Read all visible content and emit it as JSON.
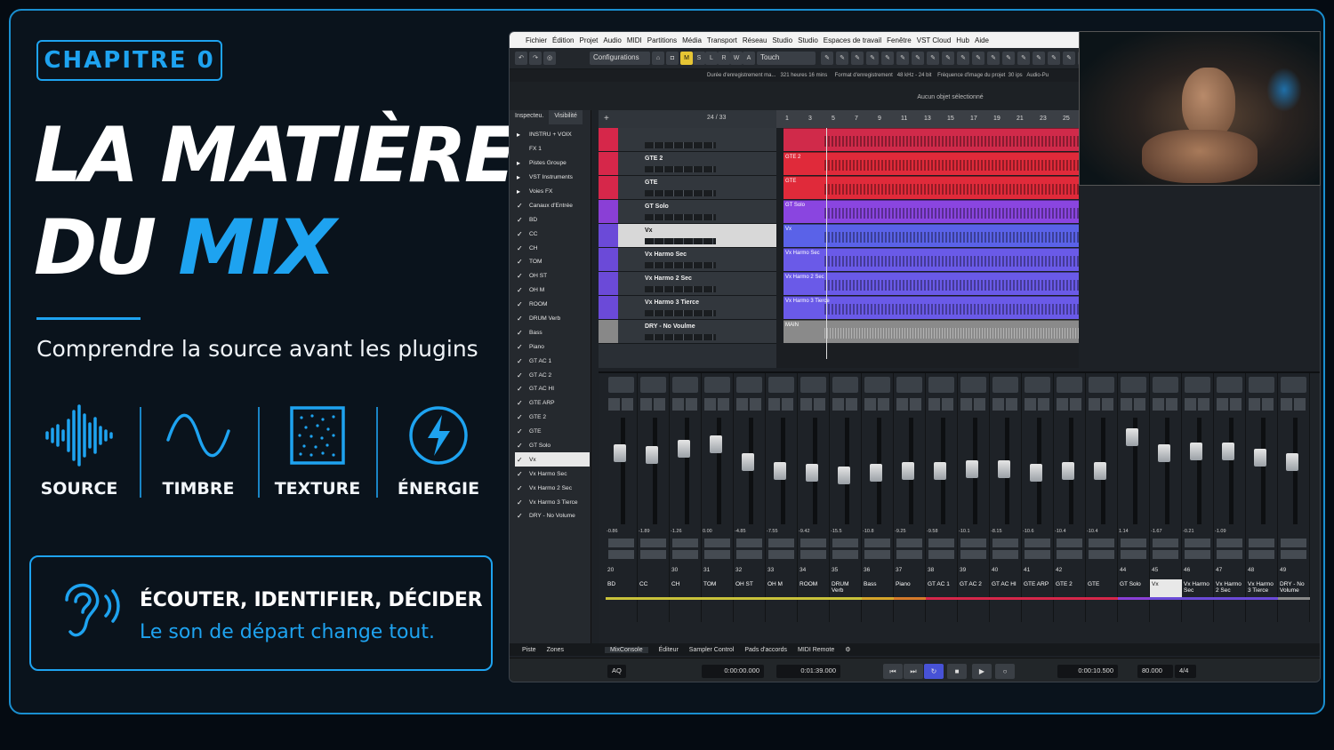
{
  "slide": {
    "chapter": "CHAPITRE 0",
    "title_line1": "LA MATIÈRE",
    "title_line2_a": "DU",
    "title_line2_b": "MIX",
    "subtitle": "Comprendre la source avant les plugins",
    "accent": "#1ea3f0",
    "features": [
      {
        "icon": "waveform-icon",
        "label": "SOURCE"
      },
      {
        "icon": "sine-wave-icon",
        "label": "TIMBRE"
      },
      {
        "icon": "noise-grid-icon",
        "label": "TEXTURE"
      },
      {
        "icon": "lightning-icon",
        "label": "ÉNERGIE"
      }
    ],
    "callout": {
      "icon": "ear-icon",
      "heading": "ÉCOUTER, IDENTIFIER, DÉCIDER",
      "text": "Le son de départ change tout."
    }
  },
  "daw": {
    "menu": [
      "Fichier",
      "Édition",
      "Projet",
      "Audio",
      "MIDI",
      "Partitions",
      "Média",
      "Transport",
      "Réseau",
      "Studio",
      "Studio",
      "Espaces de travail",
      "Fenêtre",
      "VST Cloud",
      "Hub",
      "Aide"
    ],
    "toolbar": {
      "configurations": "Configurations",
      "automation_mode": "Touch",
      "buttons": [
        "M",
        "S",
        "L",
        "R",
        "W",
        "A"
      ]
    },
    "info": {
      "rec_label": "Durée d'enregistrement ma...",
      "rec_value": "321 heures 16 mins",
      "format_label": "Format d'enregistrement",
      "format_value": "48 kHz - 24 bit",
      "fps_label": "Fréquence d'image du projet",
      "fps_value": "30 ips",
      "audio": "Audio-Pu"
    },
    "status": "Aucun objet sélectionné",
    "left_tabs": [
      "Inspecteu.",
      "Visibilité"
    ],
    "visibility": [
      {
        "label": "INSTRU + VOIX",
        "check": false,
        "folder": true
      },
      {
        "label": "FX 1",
        "check": false,
        "folder": false
      },
      {
        "label": "Pistes Groupe",
        "check": false,
        "folder": true
      },
      {
        "label": "VST Instruments",
        "check": false,
        "folder": true
      },
      {
        "label": "Voies FX",
        "check": false,
        "folder": true
      },
      {
        "label": "Canaux d'Entrée",
        "check": true,
        "folder": true
      },
      {
        "label": "BD",
        "check": true
      },
      {
        "label": "CC",
        "check": true
      },
      {
        "label": "CH",
        "check": true
      },
      {
        "label": "TOM",
        "check": true
      },
      {
        "label": "OH ST",
        "check": true
      },
      {
        "label": "OH M",
        "check": true
      },
      {
        "label": "ROOM",
        "check": true
      },
      {
        "label": "DRUM Verb",
        "check": true
      },
      {
        "label": "Bass",
        "check": true
      },
      {
        "label": "Piano",
        "check": true
      },
      {
        "label": "GT AC 1",
        "check": true
      },
      {
        "label": "GT AC 2",
        "check": true
      },
      {
        "label": "GT AC HI",
        "check": true
      },
      {
        "label": "GTE ARP",
        "check": true
      },
      {
        "label": "GTE 2",
        "check": true
      },
      {
        "label": "GTE",
        "check": true
      },
      {
        "label": "GT Solo",
        "check": true
      },
      {
        "label": "Vx",
        "check": true,
        "selected": true
      },
      {
        "label": "Vx Harmo Sec",
        "check": true
      },
      {
        "label": "Vx Harmo 2 Sec",
        "check": true
      },
      {
        "label": "Vx Harmo 3 Tierce",
        "check": true
      },
      {
        "label": "DRY - No Volume",
        "check": true
      }
    ],
    "track_counter": "24 / 33",
    "tracks": [
      {
        "name": "",
        "color": "#d6274a"
      },
      {
        "name": "GTE 2",
        "color": "#d6274a"
      },
      {
        "name": "GTE",
        "color": "#d6274a"
      },
      {
        "name": "GT Solo",
        "color": "#8a3fd6"
      },
      {
        "name": "Vx",
        "color": "#6b4ad8",
        "selected": true
      },
      {
        "name": "Vx Harmo Sec",
        "color": "#6b4ad8"
      },
      {
        "name": "Vx Harmo 2 Sec",
        "color": "#6b4ad8"
      },
      {
        "name": "Vx Harmo 3 Tierce",
        "color": "#6b4ad8"
      },
      {
        "name": "DRY - No Voulme",
        "color": "#888888"
      }
    ],
    "events": [
      {
        "label": "",
        "color": "#d02a4a"
      },
      {
        "label": "GTE 2",
        "color": "#e02a3a"
      },
      {
        "label": "GTE",
        "color": "#e02a3a"
      },
      {
        "label": "GT Solo",
        "color": "#8a45e0"
      },
      {
        "label": "Vx",
        "color": "#5a62e8"
      },
      {
        "label": "Vx Harmo Sec",
        "color": "#6a5ae8"
      },
      {
        "label": "Vx Harmo 2 Sec",
        "color": "#6a5ae8"
      },
      {
        "label": "Vx Harmo 3 Tierce",
        "color": "#6a5ae8"
      },
      {
        "label": "MAIN",
        "color": "#8a8a8a"
      }
    ],
    "ruler": [
      "1",
      "3",
      "5",
      "7",
      "9",
      "11",
      "13",
      "15",
      "17",
      "19",
      "21",
      "23",
      "25"
    ],
    "channels": [
      {
        "num": "20",
        "name": "BD",
        "db": "-0.86",
        "color": "#c9c23a"
      },
      {
        "num": "",
        "name": "CC",
        "db": "-1.89",
        "color": "#c9c23a"
      },
      {
        "num": "30",
        "name": "CH",
        "db": "-1.26",
        "color": "#c9c23a"
      },
      {
        "num": "31",
        "name": "TOM",
        "db": "0.00",
        "color": "#c9c23a"
      },
      {
        "num": "32",
        "name": "OH ST",
        "db": "-4.85",
        "color": "#c9c23a"
      },
      {
        "num": "33",
        "name": "OH M",
        "db": "-7.55",
        "color": "#c9c23a"
      },
      {
        "num": "34",
        "name": "ROOM",
        "db": "-9.42",
        "color": "#c9c23a"
      },
      {
        "num": "35",
        "name": "DRUM Verb",
        "db": "-15.5",
        "color": "#c9c23a"
      },
      {
        "num": "36",
        "name": "Bass",
        "db": "-10.8",
        "color": "#d6a52a"
      },
      {
        "num": "37",
        "name": "Piano",
        "db": "-9.25",
        "color": "#d67a2a"
      },
      {
        "num": "38",
        "name": "GT AC 1",
        "db": "-9.58",
        "color": "#d6274a"
      },
      {
        "num": "39",
        "name": "GT AC 2",
        "db": "-10.1",
        "color": "#d6274a"
      },
      {
        "num": "40",
        "name": "GT AC HI",
        "db": "-8.15",
        "color": "#d6274a"
      },
      {
        "num": "41",
        "name": "GTE ARP",
        "db": "-10.6",
        "color": "#d6274a"
      },
      {
        "num": "42",
        "name": "GTE 2",
        "db": "-10.4",
        "color": "#d6274a"
      },
      {
        "num": "",
        "name": "GTE",
        "db": "-10.4",
        "color": "#d6274a"
      },
      {
        "num": "44",
        "name": "GT Solo",
        "db": "1.14",
        "color": "#8a3fd6"
      },
      {
        "num": "45",
        "name": "Vx",
        "db": "-1.67",
        "color": "#6b4ad8"
      },
      {
        "num": "46",
        "name": "Vx Harmo Sec",
        "db": "-0.21",
        "color": "#6b4ad8"
      },
      {
        "num": "47",
        "name": "Vx Harmo 2 Sec",
        "db": "-1.09",
        "color": "#6b4ad8"
      },
      {
        "num": "48",
        "name": "Vx Harmo 3 Tierce",
        "db": "",
        "color": "#6b4ad8"
      },
      {
        "num": "49",
        "name": "DRY - No Volume",
        "db": "",
        "color": "#888888"
      }
    ],
    "bottom_tabs_left": [
      "Piste",
      "Zones"
    ],
    "bottom_tabs": [
      "MixConsole",
      "Éditeur",
      "Sampler Control",
      "Pads d'accords",
      "MIDI Remote"
    ],
    "transport": {
      "left_locator": "0:00:00.000",
      "right_locator": "0:01:39.000",
      "position": "0:00:10.500",
      "tempo": "80.000",
      "signature": "4/4",
      "aq": "AQ"
    }
  }
}
